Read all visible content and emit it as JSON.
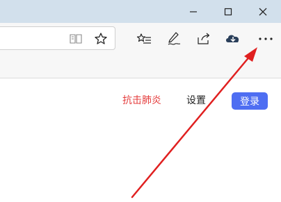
{
  "window_controls": {
    "minimize_icon": "minimize-icon",
    "maximize_icon": "maximize-icon",
    "close_icon": "close-icon"
  },
  "toolbar": {
    "icons": [
      "reading-view-icon",
      "favorite-star-icon",
      "favorites-list-icon",
      "web-note-pen-icon",
      "share-icon",
      "downloads-icon",
      "more-options-icon"
    ]
  },
  "page": {
    "promo_link": "抗击肺炎",
    "settings_link": "设置",
    "login_button": "登录"
  },
  "colors": {
    "titlebar": "#d2e0ec",
    "toolbar": "#f7f7f7",
    "promo_link": "#e43b3b",
    "login_button_bg": "#4e6ef2",
    "annotation_arrow": "#e02020"
  }
}
